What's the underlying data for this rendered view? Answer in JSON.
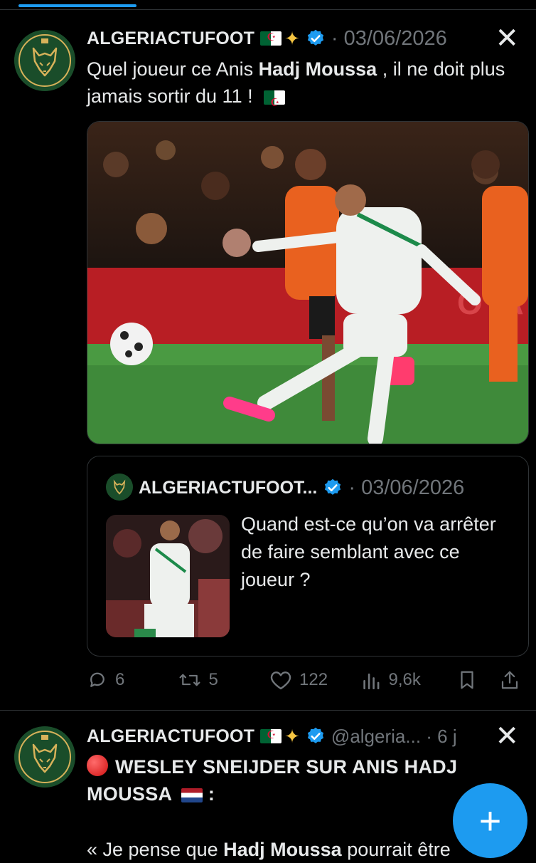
{
  "tweet1": {
    "author": "ALGERIACTUFOOT",
    "date": "· 03/06/2026",
    "text_before": "Quel joueur ce Anis ",
    "text_bold": "Hadj Moussa",
    "text_after": " , il ne doit plus jamais sortir du 11 !",
    "quote": {
      "author": "ALGERIACTUFOOT...",
      "date": "· 03/06/2026",
      "text": "Quand est-ce qu’on va arrêter de faire semblant avec ce joueur ?"
    },
    "stats": {
      "replies": "6",
      "retweets": "5",
      "likes": "122",
      "views": "9,6k"
    }
  },
  "tweet2": {
    "author": "ALGERIACTUFOOT",
    "handle": "@algeria... · 6 j",
    "headline": "WESLEY SNEIJDER SUR ANIS HADJ MOUSSA",
    "headline_suffix": " :",
    "line3_before": "« Je pense que ",
    "line3_bold": "Hadj Moussa",
    "line3_after": " pourrait être"
  },
  "colors": {
    "accent": "#1d9bf0",
    "background": "#000000",
    "muted": "#71767b"
  },
  "icons": [
    "close-icon",
    "verified-badge-icon",
    "reply-icon",
    "retweet-icon",
    "like-icon",
    "views-icon",
    "bookmark-icon",
    "share-icon",
    "compose-plus-icon"
  ]
}
